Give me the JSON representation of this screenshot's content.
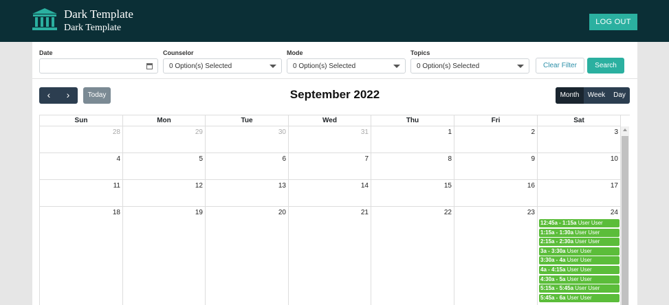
{
  "header": {
    "brand_line1": "Dark Template",
    "brand_line2": "Dark Template",
    "logout_label": "LOG OUT",
    "logo_icon": "institution-icon"
  },
  "filters": {
    "date_label": "Date",
    "date_value": "",
    "counselor_label": "Counselor",
    "counselor_value": "0 Option(s) Selected",
    "mode_label": "Mode",
    "mode_value": "0 Option(s) Selected",
    "topics_label": "Topics",
    "topics_value": "0 Option(s) Selected",
    "clear_label": "Clear Filter",
    "search_label": "Search"
  },
  "calendar": {
    "title": "September 2022",
    "today_label": "Today",
    "prev_icon": "chevron-left-icon",
    "next_icon": "chevron-right-icon",
    "views": [
      "Month",
      "Week",
      "Day"
    ],
    "active_view": "Month",
    "weekdays": [
      "Sun",
      "Mon",
      "Tue",
      "Wed",
      "Thu",
      "Fri",
      "Sat"
    ],
    "weeks": [
      [
        {
          "n": "28",
          "other": true
        },
        {
          "n": "29",
          "other": true
        },
        {
          "n": "30",
          "other": true
        },
        {
          "n": "31",
          "other": true
        },
        {
          "n": "1"
        },
        {
          "n": "2"
        },
        {
          "n": "3"
        }
      ],
      [
        {
          "n": "4"
        },
        {
          "n": "5"
        },
        {
          "n": "6"
        },
        {
          "n": "7"
        },
        {
          "n": "8"
        },
        {
          "n": "9"
        },
        {
          "n": "10"
        }
      ],
      [
        {
          "n": "11"
        },
        {
          "n": "12"
        },
        {
          "n": "13"
        },
        {
          "n": "14"
        },
        {
          "n": "15"
        },
        {
          "n": "16"
        },
        {
          "n": "17"
        }
      ],
      [
        {
          "n": "18"
        },
        {
          "n": "19"
        },
        {
          "n": "20"
        },
        {
          "n": "21"
        },
        {
          "n": "22"
        },
        {
          "n": "23"
        },
        {
          "n": "24"
        }
      ]
    ],
    "events_day": "24",
    "events": [
      {
        "time": "12:45a - 1:15a",
        "title": "User User"
      },
      {
        "time": "1:15a - 1:30a",
        "title": "User User"
      },
      {
        "time": "2:15a - 2:30a",
        "title": "User User"
      },
      {
        "time": "3a - 3:30a",
        "title": "User User"
      },
      {
        "time": "3:30a - 4a",
        "title": "User User"
      },
      {
        "time": "4a - 4:15a",
        "title": "User User"
      },
      {
        "time": "4:30a - 5a",
        "title": "User User"
      },
      {
        "time": "5:15a - 5:45a",
        "title": "User User"
      },
      {
        "time": "5:45a - 6a",
        "title": "User User"
      }
    ],
    "colors": {
      "event": "#5bbd3a",
      "accent": "#2bb0a0",
      "header": "#0b2f36"
    }
  }
}
